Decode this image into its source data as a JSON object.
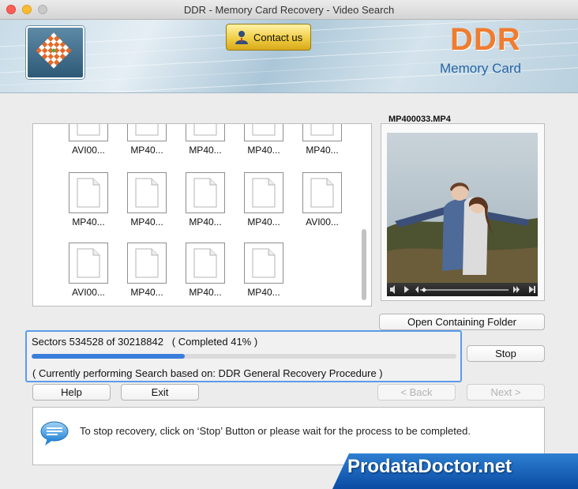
{
  "window": {
    "title": "DDR - Memory Card Recovery - Video Search"
  },
  "header": {
    "contact_label": "Contact us",
    "brand_title": "DDR",
    "brand_subtitle": "Memory Card"
  },
  "files": {
    "row0": [
      "AVI00...",
      "MP40...",
      "MP40...",
      "MP40...",
      "MP40..."
    ],
    "row1": [
      "MP40...",
      "MP40...",
      "MP40...",
      "MP40...",
      "AVI00..."
    ],
    "row2": [
      "AVI00...",
      "MP40...",
      "MP40...",
      "MP40..."
    ]
  },
  "preview": {
    "filename": "MP400033.MP4",
    "open_folder_label": "Open Containing Folder"
  },
  "progress": {
    "sectors_text": "Sectors 534528 of 30218842   ( Completed 41% )",
    "fraction": 0.36,
    "procedure_text": "( Currently performing Search based on: DDR General Recovery Procedure )"
  },
  "buttons": {
    "stop": "Stop",
    "help": "Help",
    "exit": "Exit",
    "back": "< Back",
    "next": "Next >"
  },
  "info": {
    "message": "To stop recovery, click on ‘Stop’ Button or please wait for the process to be completed."
  },
  "watermark": {
    "text": "ProdataDoctor.net"
  },
  "colors": {
    "accent": "#3a7edb",
    "brand_orange": "#f07c30",
    "brand_blue": "#2666a6",
    "banner": "#0a4ba3"
  }
}
